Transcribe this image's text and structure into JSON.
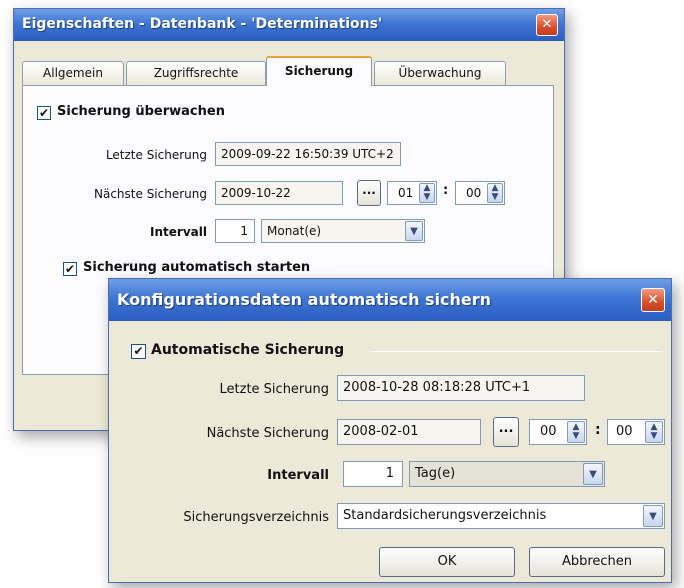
{
  "back_window": {
    "title": "Eigenschaften - Datenbank - 'Determinations'",
    "close_glyph": "✕",
    "tabs": [
      {
        "label": "Allgemein"
      },
      {
        "label": "Zugriffsrechte"
      },
      {
        "label": "Sicherung"
      },
      {
        "label": "Überwachung"
      }
    ],
    "active_tab": "Sicherung",
    "monitor_checkbox": {
      "label": "Sicherung überwachen",
      "checked": true
    },
    "last_backup": {
      "label": "Letzte Sicherung",
      "value": "2009-09-22 16:50:39 UTC+2"
    },
    "next_backup": {
      "label": "Nächste Sicherung",
      "date": "2009-10-22",
      "browse": "...",
      "hour": "01",
      "minute": "00"
    },
    "interval": {
      "label": "Intervall",
      "value": "1",
      "unit": "Monat(e)"
    },
    "auto_start_checkbox": {
      "label": "Sicherung automatisch starten",
      "checked": true
    }
  },
  "front_window": {
    "title": "Konfigurationsdaten automatisch sichern",
    "close_glyph": "✕",
    "auto_checkbox": {
      "label": "Automatische Sicherung",
      "checked": true
    },
    "last_backup": {
      "label": "Letzte Sicherung",
      "value": "2008-10-28 08:18:28 UTC+1"
    },
    "next_backup": {
      "label": "Nächste Sicherung",
      "date": "2008-02-01",
      "browse": "...",
      "hour": "00",
      "minute": "00"
    },
    "interval": {
      "label": "Intervall",
      "value": "1",
      "unit": "Tag(e)"
    },
    "directory": {
      "label": "Sicherungsverzeichnis",
      "value": "Standardsicherungsverzeichnis"
    },
    "ok_label": "OK",
    "cancel_label": "Abbrechen"
  },
  "glyphs": {
    "colon": ":",
    "check": "✔",
    "spin_up": "▲",
    "spin_down": "▼",
    "dropdown": "▼"
  },
  "colors": {
    "titlebar": "#3f76d4",
    "dialog_bg": "#ece9d8",
    "close": "#d6502d",
    "tab_highlight": "#e8a33c"
  }
}
